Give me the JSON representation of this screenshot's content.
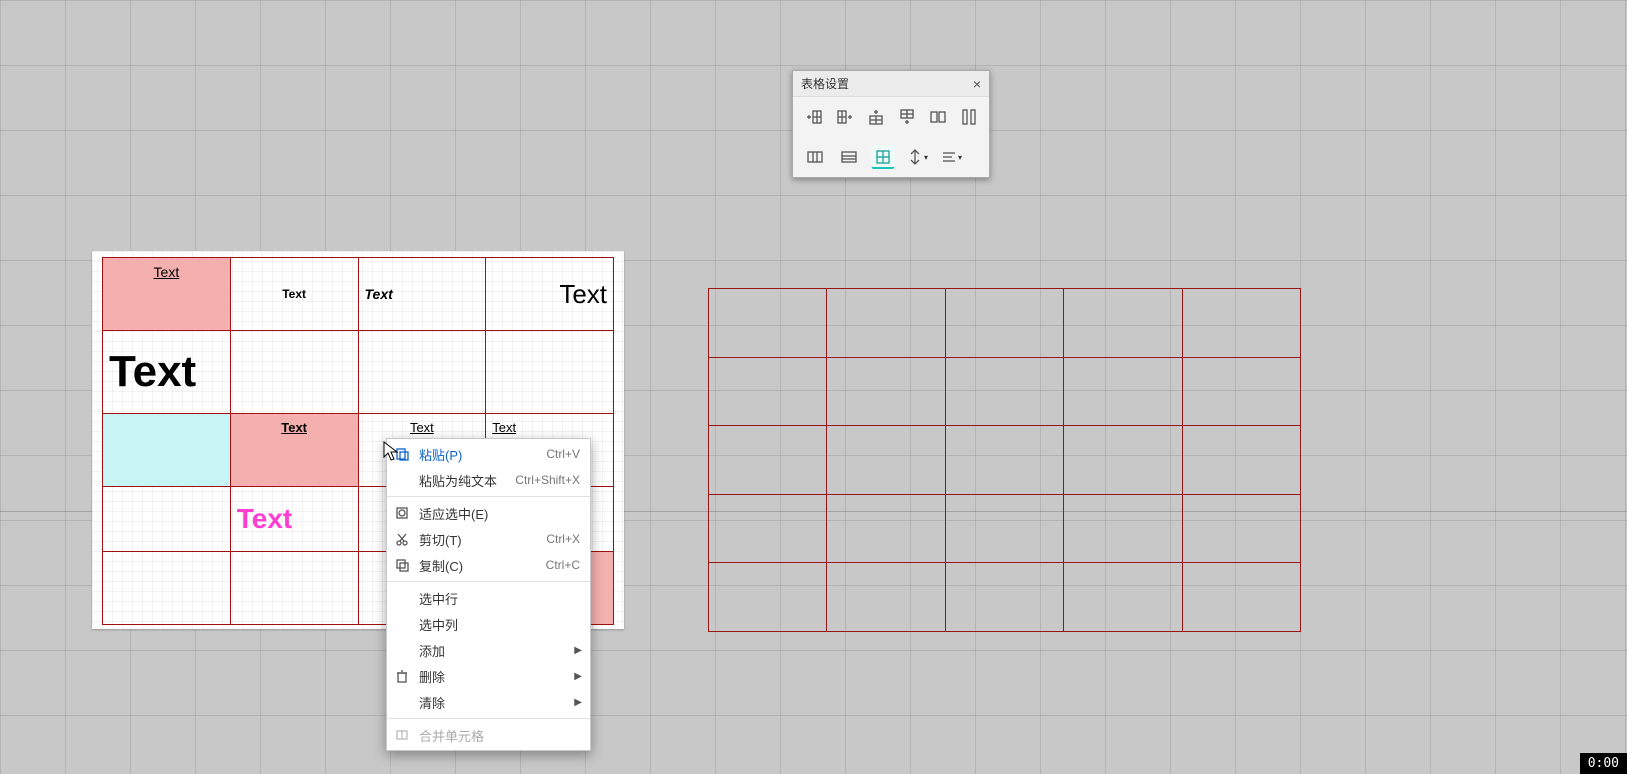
{
  "toolbar": {
    "title": "表格设置",
    "buttons_row1": [
      "insert-col-left",
      "insert-col-right",
      "insert-row-above",
      "insert-row-below",
      "split-horizontal",
      "split-vertical"
    ],
    "buttons_row2": [
      "distribute-cols",
      "distribute-rows",
      "border-bottom",
      "align-vertical",
      "align-horizontal"
    ]
  },
  "table1": {
    "rows": 5,
    "cols": 4,
    "cells": {
      "r0c0": "Text",
      "r0c1": "Text",
      "r0c2": "Text",
      "r0c3": "Text",
      "r1c0": "Text",
      "r2c1": "Text",
      "r2c2": "Text",
      "r2c3": "Text",
      "r3c1": "Text"
    }
  },
  "table2": {
    "rows": 5,
    "cols": 5
  },
  "context_menu": {
    "paste": {
      "label": "粘贴(P)",
      "shortcut": "Ctrl+V"
    },
    "paste_plain": {
      "label": "粘贴为纯文本",
      "shortcut": "Ctrl+Shift+X"
    },
    "fit_select": {
      "label": "适应选中(E)",
      "shortcut": ""
    },
    "cut": {
      "label": "剪切(T)",
      "shortcut": "Ctrl+X"
    },
    "copy": {
      "label": "复制(C)",
      "shortcut": "Ctrl+C"
    },
    "select_row": {
      "label": "选中行",
      "shortcut": ""
    },
    "select_col": {
      "label": "选中列",
      "shortcut": ""
    },
    "add": {
      "label": "添加",
      "shortcut": ""
    },
    "delete": {
      "label": "删除",
      "shortcut": ""
    },
    "clear": {
      "label": "清除",
      "shortcut": ""
    },
    "merge": {
      "label": "合并单元格",
      "shortcut": ""
    }
  },
  "timer": "0:00"
}
